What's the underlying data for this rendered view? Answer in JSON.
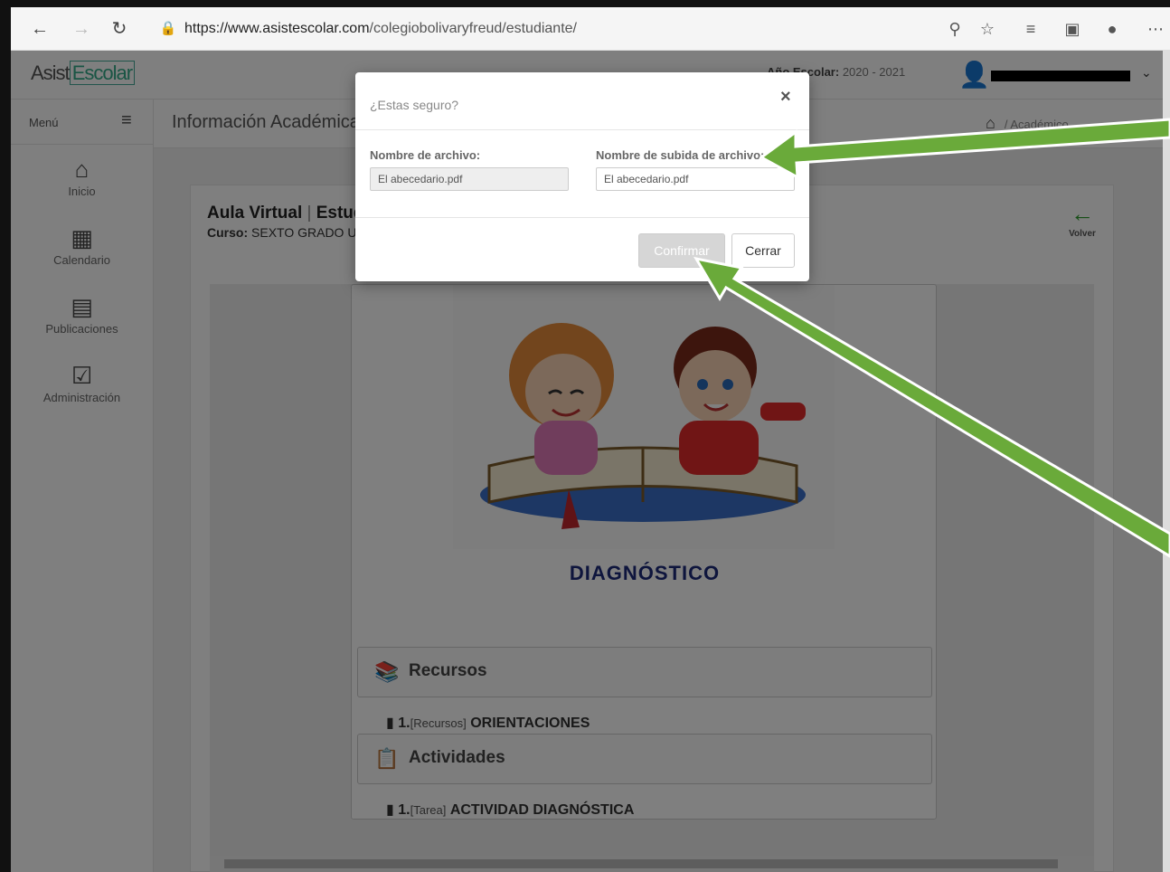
{
  "browser": {
    "url_host": "https://www.asistescolar.com",
    "url_path": "/colegiobolivaryfreud/estudiante/"
  },
  "app": {
    "logo_a": "Asist",
    "logo_b": "Escolar",
    "year_label": "Año Escolar:",
    "year_value": "2020 - 2021"
  },
  "sidebar": {
    "menu_label": "Menú",
    "items": [
      {
        "label": "Inicio",
        "icon": "home-icon"
      },
      {
        "label": "Calendario",
        "icon": "calendar-icon"
      },
      {
        "label": "Publicaciones",
        "icon": "newspaper-icon"
      },
      {
        "label": "Administración",
        "icon": "checkbox-icon"
      }
    ]
  },
  "header": {
    "title": "Información Académica",
    "breadcrumb": "/  Académico"
  },
  "panel": {
    "title_a": "Aula Virtual",
    "title_sep": "|",
    "title_b": "Estudiante",
    "curso_label": "Curso:",
    "curso_value": "SEXTO GRADO U",
    "back_label": "Volver"
  },
  "card": {
    "heading": "DIAGNÓSTICO",
    "sections": [
      {
        "title": "Recursos",
        "link_num": "1.",
        "link_tag": "[Recursos]",
        "link_name": "ORIENTACIONES"
      },
      {
        "title": "Actividades",
        "link_num": "1.",
        "link_tag": "[Tarea]",
        "link_name": "ACTIVIDAD DIAGNÓSTICA"
      }
    ]
  },
  "modal": {
    "title": "¿Estas seguro?",
    "close": "×",
    "field1_label": "Nombre de archivo:",
    "field1_value": "El abecedario.pdf",
    "field2_label": "Nombre de subida de archivo:",
    "field2_value": "El abecedario.pdf",
    "confirm_label": "Confirmar",
    "close_label": "Cerrar"
  },
  "colors": {
    "arrow": "#6aaa3a",
    "heading": "#1d2a7a"
  }
}
